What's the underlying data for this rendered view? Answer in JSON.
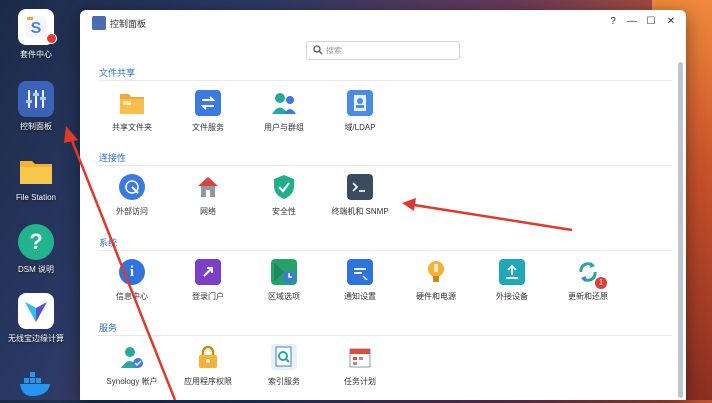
{
  "desktop": {
    "dock": [
      {
        "label": "套件中心",
        "icon": "package-center-icon"
      },
      {
        "label": "控制面板",
        "icon": "control-panel-icon"
      },
      {
        "label": "File Station",
        "icon": "folder-icon"
      },
      {
        "label": "DSM 说明",
        "icon": "help-icon"
      },
      {
        "label": "无线宝边缘计算",
        "icon": "wireless-edge-icon"
      },
      {
        "label": "",
        "icon": "docker-icon"
      }
    ]
  },
  "window": {
    "title": "控制面板",
    "controls": {
      "help": "?",
      "minimize": "—",
      "maximize": "☐",
      "close": "✕"
    },
    "search_placeholder": "搜索",
    "sections": [
      {
        "title": "文件共享",
        "items": [
          {
            "label": "共享文件夹",
            "icon": "shared-folder-icon"
          },
          {
            "label": "文件服务",
            "icon": "file-services-icon"
          },
          {
            "label": "用户与群组",
            "icon": "user-group-icon"
          },
          {
            "label": "域/LDAP",
            "icon": "domain-ldap-icon"
          }
        ]
      },
      {
        "title": "连接性",
        "items": [
          {
            "label": "外部访问",
            "icon": "external-access-icon"
          },
          {
            "label": "网络",
            "icon": "network-icon"
          },
          {
            "label": "安全性",
            "icon": "security-icon"
          },
          {
            "label": "终端机和 SNMP",
            "icon": "terminal-snmp-icon"
          }
        ]
      },
      {
        "title": "系统",
        "items": [
          {
            "label": "信息中心",
            "icon": "info-center-icon"
          },
          {
            "label": "登录门户",
            "icon": "login-portal-icon"
          },
          {
            "label": "区域选项",
            "icon": "regional-options-icon"
          },
          {
            "label": "通知设置",
            "icon": "notification-icon"
          },
          {
            "label": "硬件和电源",
            "icon": "hardware-power-icon"
          },
          {
            "label": "外接设备",
            "icon": "external-devices-icon"
          },
          {
            "label": "更新和还原",
            "icon": "update-restore-icon",
            "badge": "1"
          }
        ]
      },
      {
        "title": "服务",
        "items": [
          {
            "label": "Synology 帐户",
            "icon": "synology-account-icon"
          },
          {
            "label": "应用程序权限",
            "icon": "app-privileges-icon"
          },
          {
            "label": "索引服务",
            "icon": "indexing-service-icon"
          },
          {
            "label": "任务计划",
            "icon": "task-scheduler-icon"
          }
        ]
      }
    ]
  },
  "colors": {
    "accent": "#2e6bd6",
    "annotation_arrow": "#e0392b"
  }
}
